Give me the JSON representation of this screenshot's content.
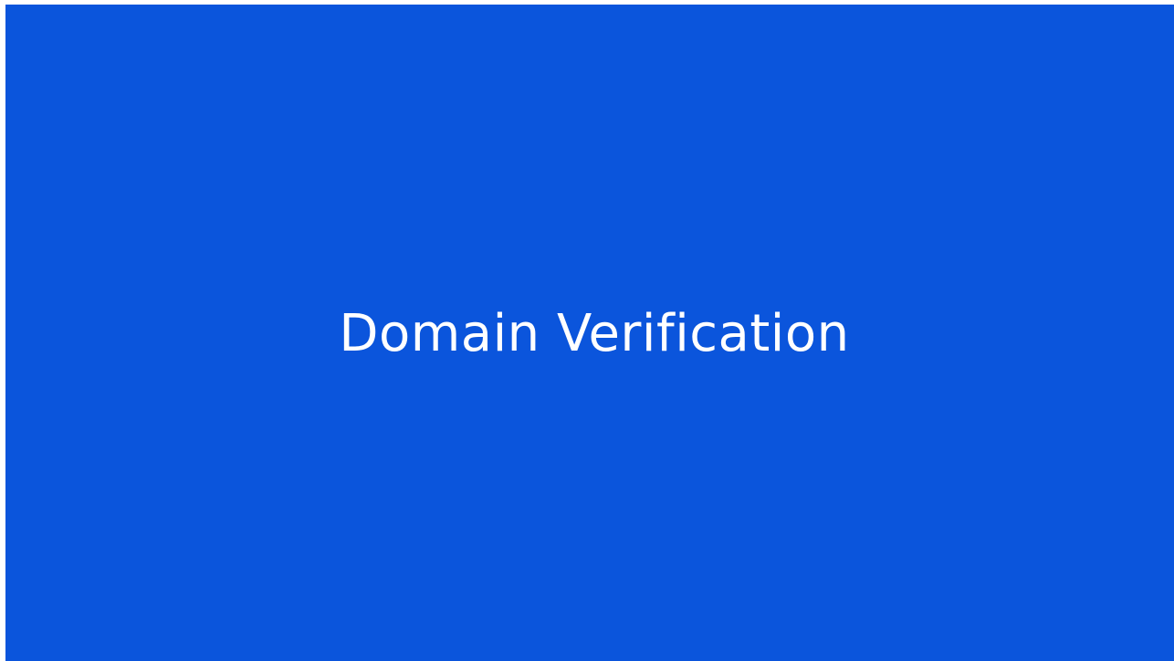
{
  "slide": {
    "title": "Domain Verification"
  },
  "colors": {
    "background": "#0b55dc",
    "text": "#ffffff"
  }
}
